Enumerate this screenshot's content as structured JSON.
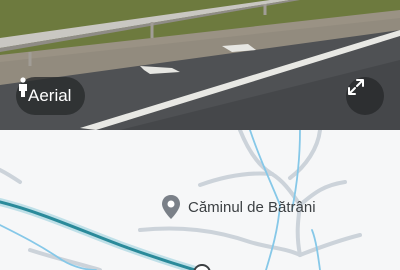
{
  "street_view": {
    "aerial_label": "Aerial",
    "person_icon": "person-icon",
    "expand_icon": "expand-icon"
  },
  "map": {
    "place_name": "Căminul de Bătrâni",
    "place_icon": "map-pin-icon",
    "colors": {
      "road_outline": "#c8d0d8",
      "highlighted_road": "#2a8a9a",
      "waterway": "#86c8e8",
      "background": "#f6f7f8"
    }
  }
}
